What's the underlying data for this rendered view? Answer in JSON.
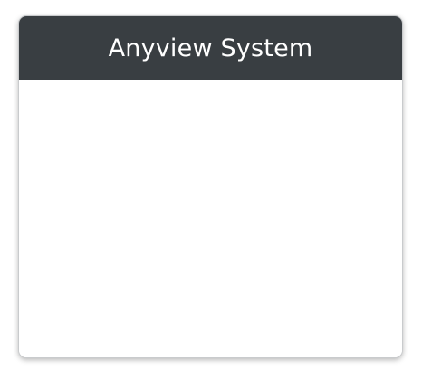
{
  "window": {
    "title": "Anyview System",
    "colors": {
      "header_background": "#393e42",
      "header_text": "#ffffff",
      "body_background": "#ffffff",
      "border": "#c9cbcd"
    }
  }
}
